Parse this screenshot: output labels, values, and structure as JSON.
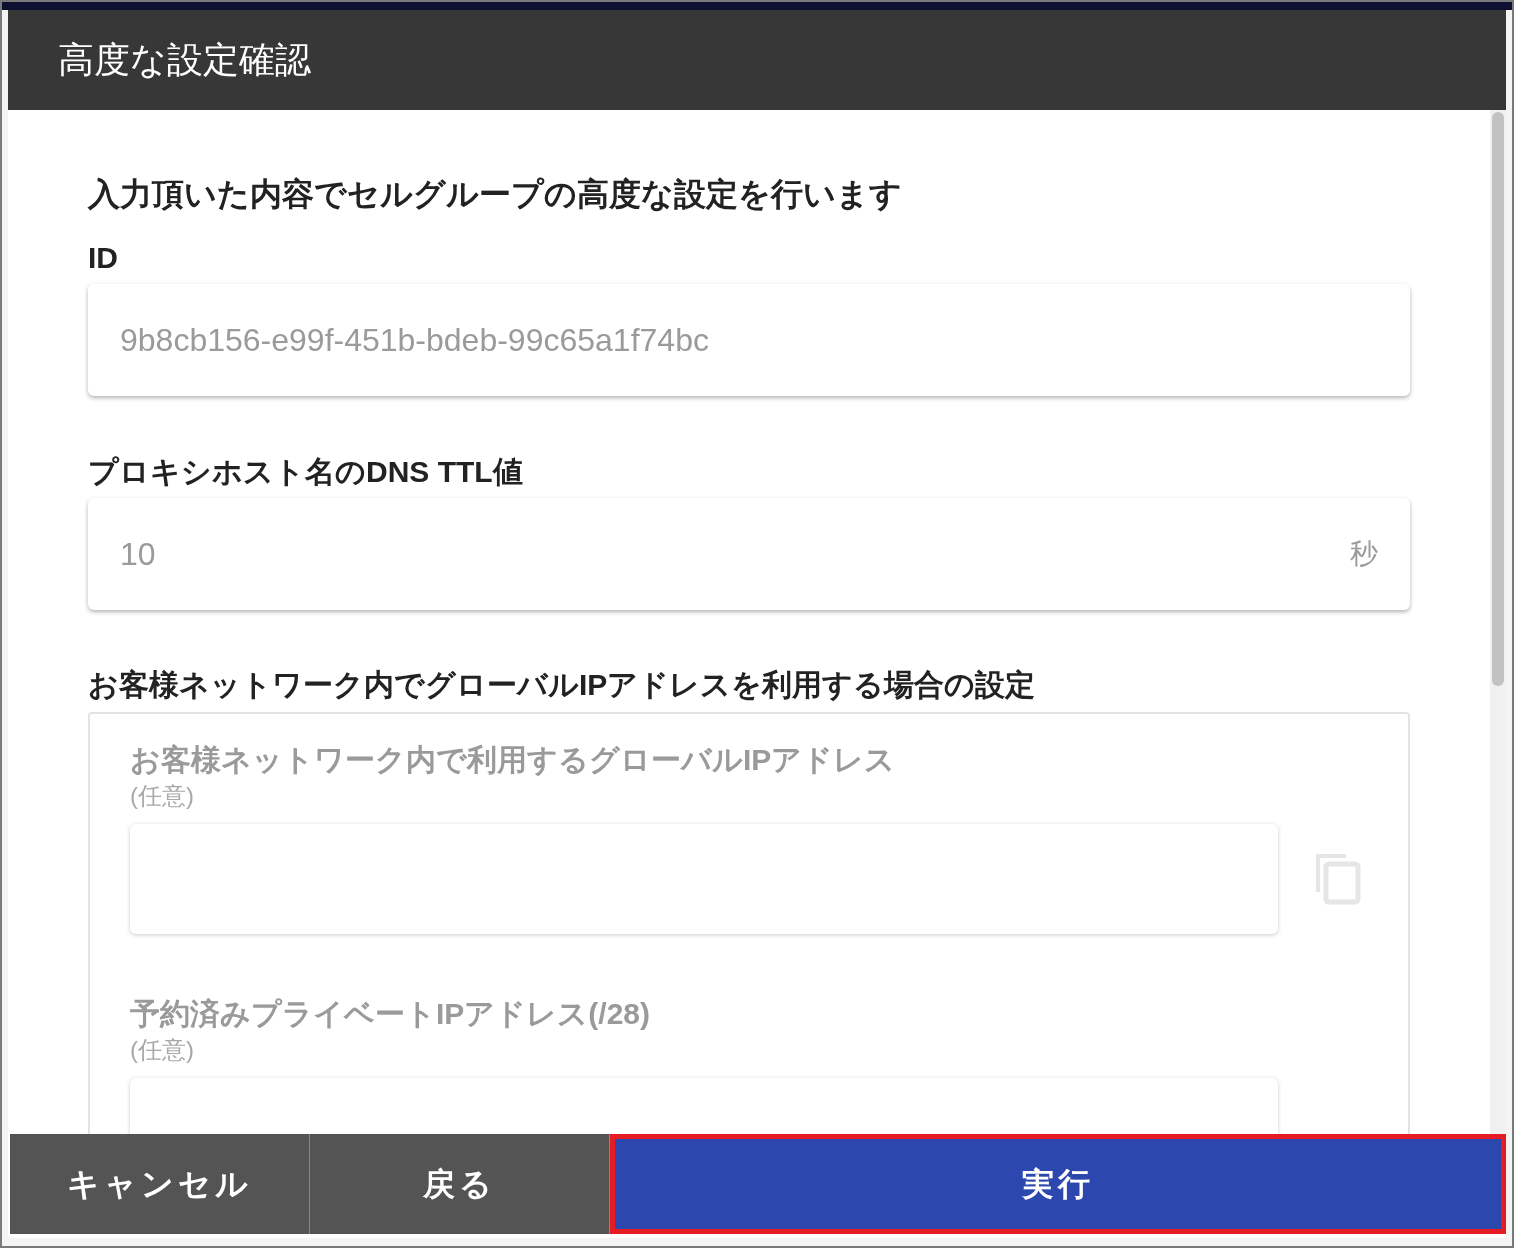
{
  "dialog": {
    "title": "高度な設定確認"
  },
  "intro": "入力頂いた内容でセルグループの高度な設定を行います",
  "fields": [
    {
      "label": "ID",
      "value": "9b8cb156-e99f-451b-bdeb-99c65a1f74bc"
    },
    {
      "label": "プロキシホスト名のDNS TTL値",
      "value": "10",
      "unit": "秒"
    }
  ],
  "group": {
    "title": "お客様ネットワーク内でグローバルIPアドレスを利用する場合の設定",
    "items": [
      {
        "label": "お客様ネットワーク内で利用するグローバルIPアドレス",
        "hint": "(任意)",
        "copy": true
      },
      {
        "label": "予約済みプライベートIPアドレス(/28)",
        "hint": "(任意)",
        "copy": false
      }
    ]
  },
  "buttons": [
    {
      "label": "キャンセル",
      "kind": "secondary",
      "highlighted": false
    },
    {
      "label": "戻る",
      "kind": "secondary",
      "highlighted": false
    },
    {
      "label": "実行",
      "kind": "primary",
      "highlighted": true
    }
  ]
}
